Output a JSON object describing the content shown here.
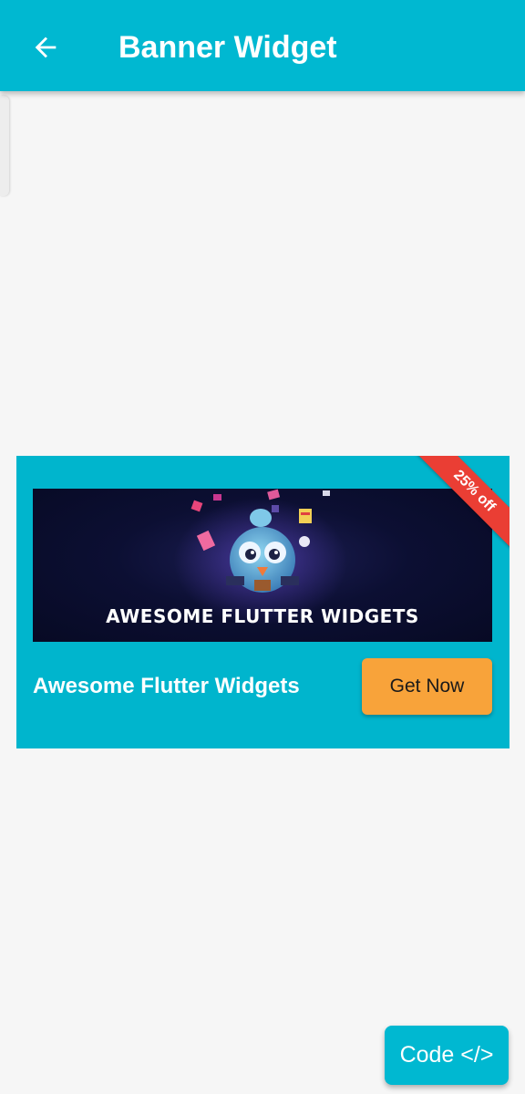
{
  "appbar": {
    "title": "Banner Widget",
    "back_icon": "arrow-left-icon",
    "color": "#00b8d1"
  },
  "banner": {
    "ribbon_text": "25% off",
    "image_caption": "AWESOME FLUTTER WIDGETS",
    "title": "Awesome Flutter Widgets",
    "button_label": "Get Now",
    "background_color": "#00b5cd",
    "ribbon_color": "#ea3e34",
    "button_color": "#f8a33a"
  },
  "fab": {
    "label": "Code </>"
  }
}
